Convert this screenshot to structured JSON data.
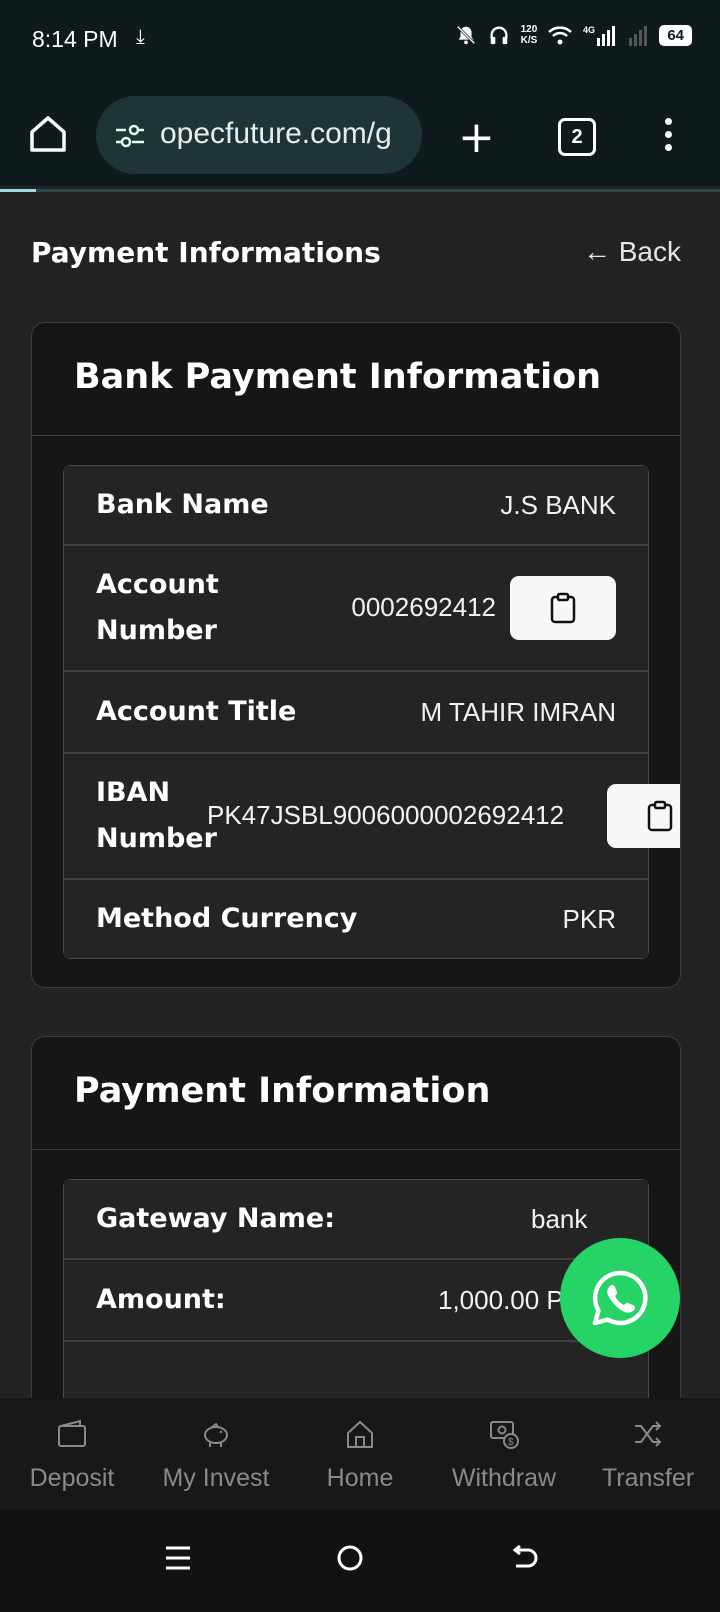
{
  "status_bar": {
    "time": "8:14 PM",
    "net_speed_value": "120",
    "net_speed_unit": "K/S",
    "battery": "64"
  },
  "browser": {
    "url": "opecfuture.com/g",
    "tab_count": "2",
    "load_progress": 0.05
  },
  "page": {
    "title": "Payment Informations",
    "back_label": "← Back"
  },
  "bank_card": {
    "title": "Bank Payment Information",
    "rows": [
      {
        "label": "Bank Name",
        "value": "J.S BANK"
      },
      {
        "label_line1": "Account",
        "label_line2": "Number",
        "value": "0002692412"
      },
      {
        "label": "Account Title",
        "value": "M TAHIR IMRAN"
      },
      {
        "label_line1": "IBAN",
        "label_line2": "Number",
        "value": "PK47JSBL9006000002692412"
      },
      {
        "label": "Method Currency",
        "value": "PKR"
      }
    ]
  },
  "payment_card": {
    "title": "Payment Information",
    "rows": [
      {
        "label": "Gateway Name:",
        "value": "bank"
      },
      {
        "label": "Amount:",
        "value": "1,000.00 PKR"
      }
    ]
  },
  "bottom_nav": {
    "items": [
      {
        "label": "Deposit",
        "icon": "wallet-icon"
      },
      {
        "label": "My Invest",
        "icon": "piggy-bank-icon"
      },
      {
        "label": "Home",
        "icon": "home-icon"
      },
      {
        "label": "Withdraw",
        "icon": "money-icon"
      },
      {
        "label": "Transfer",
        "icon": "shuffle-icon"
      }
    ]
  },
  "colors": {
    "background": "#222222",
    "card": "#161616",
    "whatsapp": "#25d366",
    "browser_bar": "#0f1a1d"
  }
}
